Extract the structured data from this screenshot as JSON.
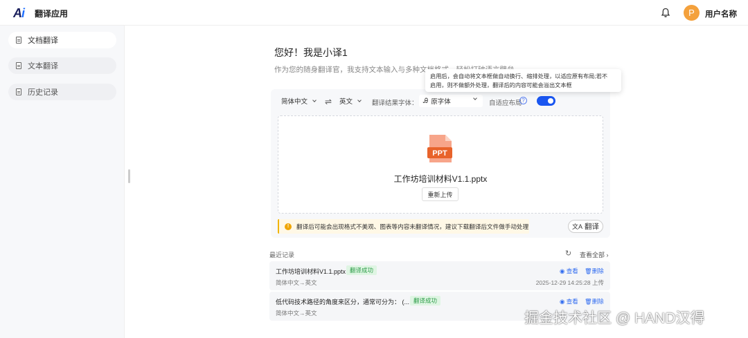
{
  "header": {
    "logo_text": "Ai",
    "app_title": "翻译应用",
    "avatar_letter": "P",
    "user_name": "用户名称"
  },
  "sidebar": {
    "items": [
      {
        "label": "文档翻译",
        "active": true
      },
      {
        "label": "文本翻译",
        "active": false
      },
      {
        "label": "历史记录",
        "active": false
      }
    ]
  },
  "main": {
    "greeting": "您好！我是小译1",
    "intro": "作为您的随身翻译官，我支持文本输入与多种文档格式，轻松打破语言壁垒",
    "source_lang": "简体中文",
    "swap_icon": "⇌",
    "target_lang": "英文",
    "font_label": "翻译结果字体：",
    "font_value": "原字体",
    "adaptive_label": "自适应布局",
    "adaptive_on": true,
    "tooltip_line1": "启用后，会自动将文本框做自动换行、缩排处理，以适应原有布局;若不",
    "tooltip_line2": "启用，则不做额外处理，翻译后的内容可能会溢出文本框",
    "file_icon_text": "PPT",
    "file_name": "工作坊培训材料V1.1.pptx",
    "reupload_label": "重新上传",
    "warning_text": "翻译后可能会出现格式不美观、图表等内容未翻译情况，建议下载翻译后文件做手动处理",
    "translate_label": "翻译",
    "accent_color": "#1a56f0"
  },
  "recent": {
    "title": "最近记录",
    "view_all": "查看全部 ›",
    "view_label": "查看",
    "delete_label": "删除",
    "records": [
      {
        "name": "工作坊培训材料V1.1.pptx",
        "status": "翻译成功",
        "lang": "简体中文→英文",
        "time": "2025-12-29 14:25:28 上传"
      },
      {
        "name": "低代码技术路径的角度来区分，通常可分为：   (...",
        "status": "翻译成功",
        "lang": "简体中文→英文",
        "time": ""
      }
    ]
  },
  "watermark": "掘金技术社区 @ HAND汉得"
}
